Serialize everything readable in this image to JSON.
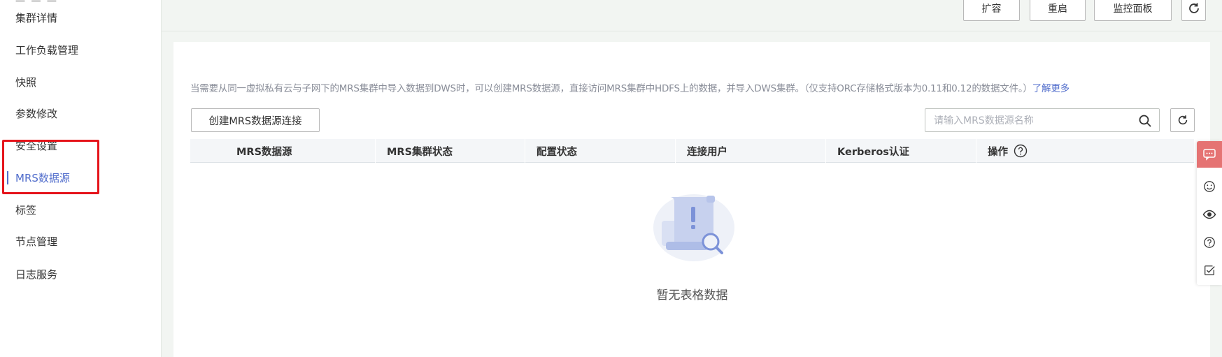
{
  "sidebar": {
    "cut_text": "一 一 一",
    "items": [
      {
        "label": "集群详情"
      },
      {
        "label": "工作负载管理"
      },
      {
        "label": "快照"
      },
      {
        "label": "参数修改"
      },
      {
        "label": "安全设置"
      },
      {
        "label": "MRS数据源",
        "active": true
      },
      {
        "label": "标签"
      },
      {
        "label": "节点管理"
      },
      {
        "label": "日志服务"
      }
    ]
  },
  "toolbar": {
    "scale_label": "扩容",
    "restart_label": "重启",
    "monitor_label": "监控面板",
    "refresh_icon": "refresh-icon"
  },
  "main": {
    "info_text": "当需要从同一虚拟私有云与子网下的MRS集群中导入数据到DWS时，可以创建MRS数据源，直接访问MRS集群中HDFS上的数据，并导入DWS集群。（仅支持ORC存储格式版本为0.11和0.12的数据文件。）",
    "learn_more": "了解更多",
    "create_button": "创建MRS数据源连接",
    "search_placeholder": "请输入MRS数据源名称",
    "table": {
      "columns": [
        "MRS数据源",
        "MRS集群状态",
        "配置状态",
        "连接用户",
        "Kerberos认证",
        "操作"
      ],
      "rows": []
    },
    "empty_text": "暂无表格数据"
  },
  "float_tools": [
    "chat-icon",
    "smile-icon",
    "eye-icon",
    "help-icon",
    "checklist-icon"
  ],
  "colors": {
    "accent": "#526ecc",
    "highlight_red": "#e5141b",
    "float_red": "#e57373"
  }
}
